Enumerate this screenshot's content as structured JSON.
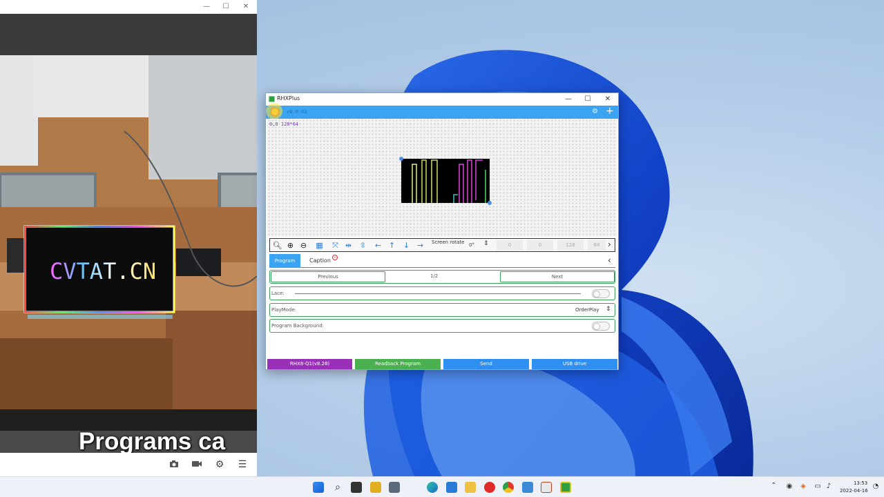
{
  "camera_window": {
    "caption": "Programs ca",
    "led_sign_text": "CVTAT.CN",
    "tools": [
      {
        "icon": "camera-icon"
      },
      {
        "icon": "video-camera-icon"
      },
      {
        "icon": "gear-icon"
      },
      {
        "icon": "menu-icon"
      }
    ]
  },
  "rhx": {
    "title": "RHXPlus",
    "version": "v8.0.63",
    "canvas_coords": "0,0 128*64",
    "toolbar": {
      "screen_rotate_label": "Screen rotate",
      "rotate_value": "0°",
      "fields": [
        "0",
        "0",
        "128",
        "64"
      ]
    },
    "tabs": {
      "program": "Program",
      "caption": "Caption"
    },
    "pager": {
      "previous": "Previous",
      "page": "1/2",
      "next": "Next"
    },
    "lace_label": "Lace:",
    "playmode_label": "PlayMode:",
    "playmode_value": "OrderPlay",
    "program_background_label": "Program Background:",
    "buttons": {
      "device": "RHX8-Q1(v8.28)",
      "readback": "Readback Program",
      "send": "Send",
      "usb": "USB drive"
    },
    "colors": {
      "accent": "#3aa4f2",
      "device": "#9b30b8",
      "readback": "#4bb04f",
      "send": "#2f8ff0",
      "usb": "#2f8ff0"
    }
  },
  "taskbar": {
    "time": "13:53",
    "date": "2022-04-16",
    "apps": [
      "start-icon",
      "search-icon",
      "task-view-icon",
      "paint-icon",
      "calculator-icon",
      "edge-icon",
      "mail-icon",
      "file-explorer-icon",
      "opera-icon",
      "chrome-icon",
      "app-icon",
      "pdf-icon",
      "rhxplus-icon"
    ]
  }
}
